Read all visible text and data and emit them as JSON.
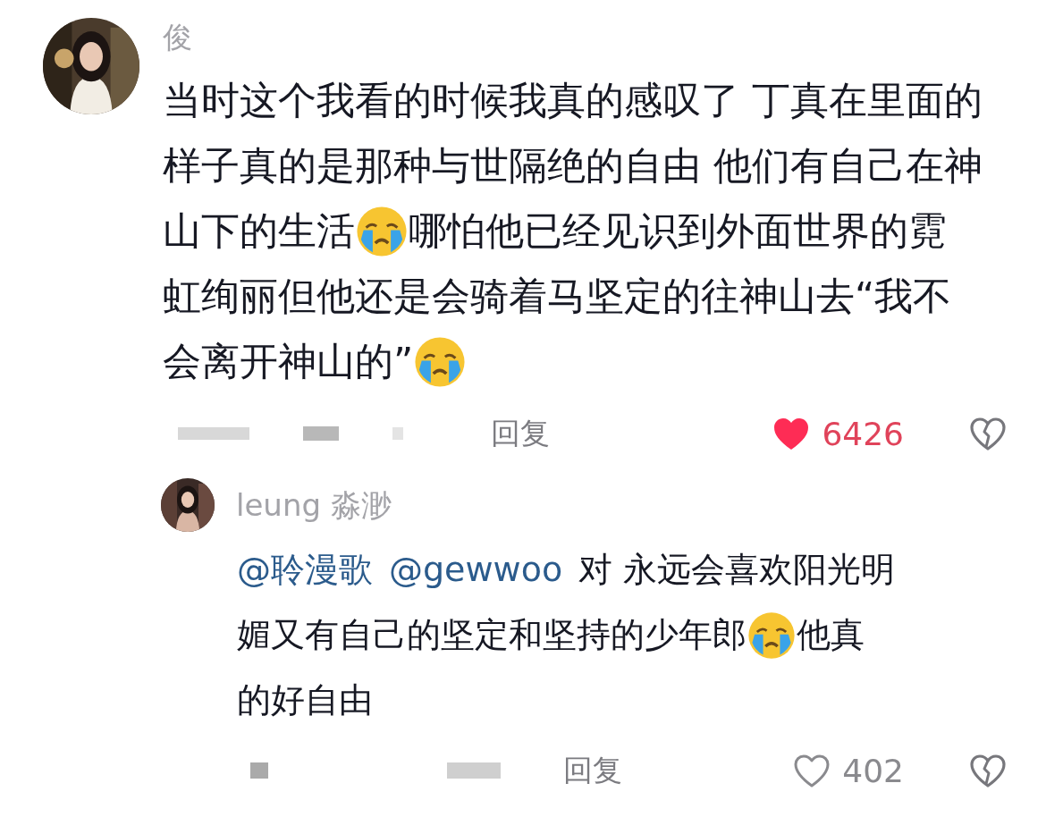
{
  "comments": [
    {
      "author": "俊",
      "lines": [
        [
          {
            "kind": "text",
            "text": "当时这个我看的时候我真的感叹了 丁真在里面的"
          }
        ],
        [
          {
            "kind": "text",
            "text": "样子真的是那种与世隔绝的自由 他们有自己在神"
          }
        ],
        [
          {
            "kind": "text",
            "text": "山下的生活"
          },
          {
            "kind": "emoji"
          },
          {
            "kind": "text",
            "text": "哪怕他已经见识到外面世界的霓"
          }
        ],
        [
          {
            "kind": "text",
            "text": "虹绚丽但他还是会骑着马坚定的往神山去“我不"
          }
        ],
        [
          {
            "kind": "text",
            "text": "会离开神山的”"
          },
          {
            "kind": "emoji"
          }
        ]
      ],
      "reply_label": "回复",
      "likes": "6426",
      "liked": true,
      "replies": [
        {
          "author": "leung 淼渺",
          "lines": [
            [
              {
                "kind": "mention",
                "text": "@聆漫歌"
              },
              {
                "kind": "mention",
                "text": "@gewwoo"
              },
              {
                "kind": "text",
                "text": "对 永远会喜欢阳光明"
              }
            ],
            [
              {
                "kind": "text",
                "text": "媚又有自己的坚定和坚持的少年郎"
              },
              {
                "kind": "emoji"
              },
              {
                "kind": "text",
                "text": "他真"
              }
            ],
            [
              {
                "kind": "text",
                "text": "的好自由"
              }
            ]
          ],
          "reply_label": "回复",
          "likes": "402",
          "liked": false
        }
      ]
    }
  ]
}
